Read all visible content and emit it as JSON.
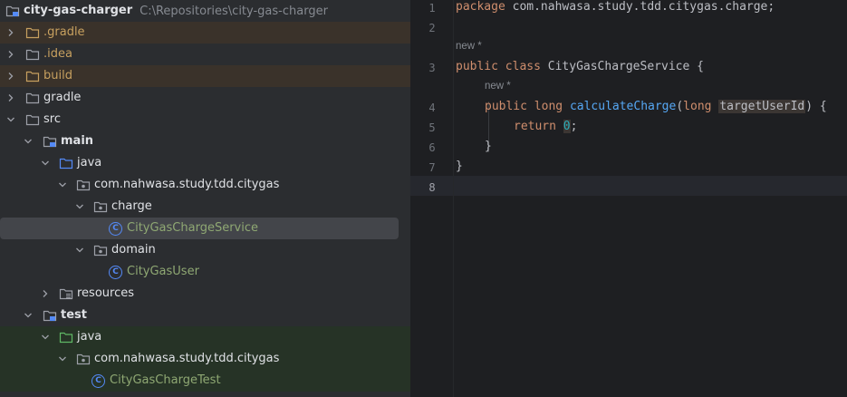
{
  "project": {
    "root_name": "city-gas-charger",
    "root_path": "C:\\Repositories\\city-gas-charger",
    "items": {
      "gradle_dot": ".gradle",
      "idea": ".idea",
      "build": "build",
      "gradle": "gradle",
      "src": "src",
      "main": "main",
      "java_main": "java",
      "pkg_main": "com.nahwasa.study.tdd.citygas",
      "charge": "charge",
      "service_class": "CityGasChargeService",
      "domain": "domain",
      "user_class": "CityGasUser",
      "resources": "resources",
      "test": "test",
      "java_test": "java",
      "pkg_test": "com.nahwasa.study.tdd.citygas",
      "test_class": "CityGasChargeTest"
    }
  },
  "editor": {
    "line_numbers": [
      "1",
      "2",
      "3",
      "4",
      "5",
      "6",
      "7",
      "8"
    ],
    "hint_class": "new *",
    "hint_method": "new *",
    "line1": {
      "kw": "package",
      "rest": " com.nahwasa.study.tdd.citygas.charge;"
    },
    "line3": {
      "kw1": "public",
      "kw2": "class",
      "name": " CityGasChargeService {"
    },
    "line4": {
      "kw1": "public",
      "kw2": "long",
      "fn": "calculateCharge",
      "open": "(",
      "kw3": "long",
      "param": "targetUserId",
      "close": ") {"
    },
    "line5": {
      "kw": "return",
      "num": "0",
      "end": ";"
    },
    "line6": "}",
    "line7": "}"
  }
}
